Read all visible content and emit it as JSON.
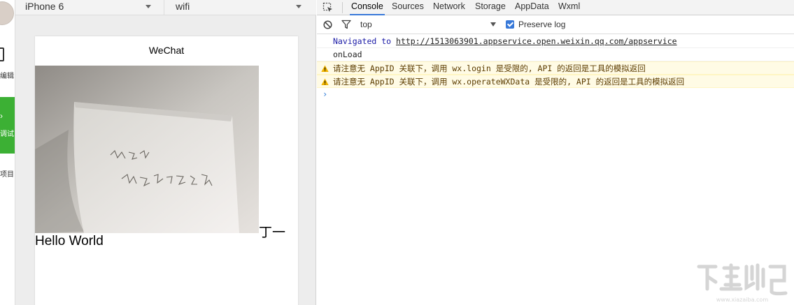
{
  "left_strip": {
    "edit_label": "编辑",
    "debug_label": "调试",
    "project_label": "项目"
  },
  "simulator": {
    "device": "iPhone 6",
    "network": "wifi",
    "page_title": "WeChat",
    "inline_text": "丁一",
    "hello_text": "Hello World"
  },
  "devtools": {
    "tabs": [
      "Console",
      "Sources",
      "Network",
      "Storage",
      "AppData",
      "Wxml"
    ],
    "active_tab": "Console",
    "context": "top",
    "preserve_log_label": "Preserve log",
    "preserve_log_checked": true
  },
  "console": {
    "navigated_prefix": "Navigated to ",
    "navigated_url": "http://1513063901.appservice.open.weixin.qq.com/appservice",
    "onload": "onLoad",
    "warn1": "请注意无 AppID 关联下，调用 wx.login 是受限的, API 的返回是工具的模拟返回",
    "warn2": "请注意无 AppID 关联下，调用 wx.operateWXData 是受限的, API 的返回是工具的模拟返回",
    "prompt": "›"
  },
  "colors": {
    "accent_green": "#3cb034",
    "tab_underline": "#3879d9",
    "warning_bg": "#fffbe5",
    "nav_link": "#1a1aa6"
  }
}
